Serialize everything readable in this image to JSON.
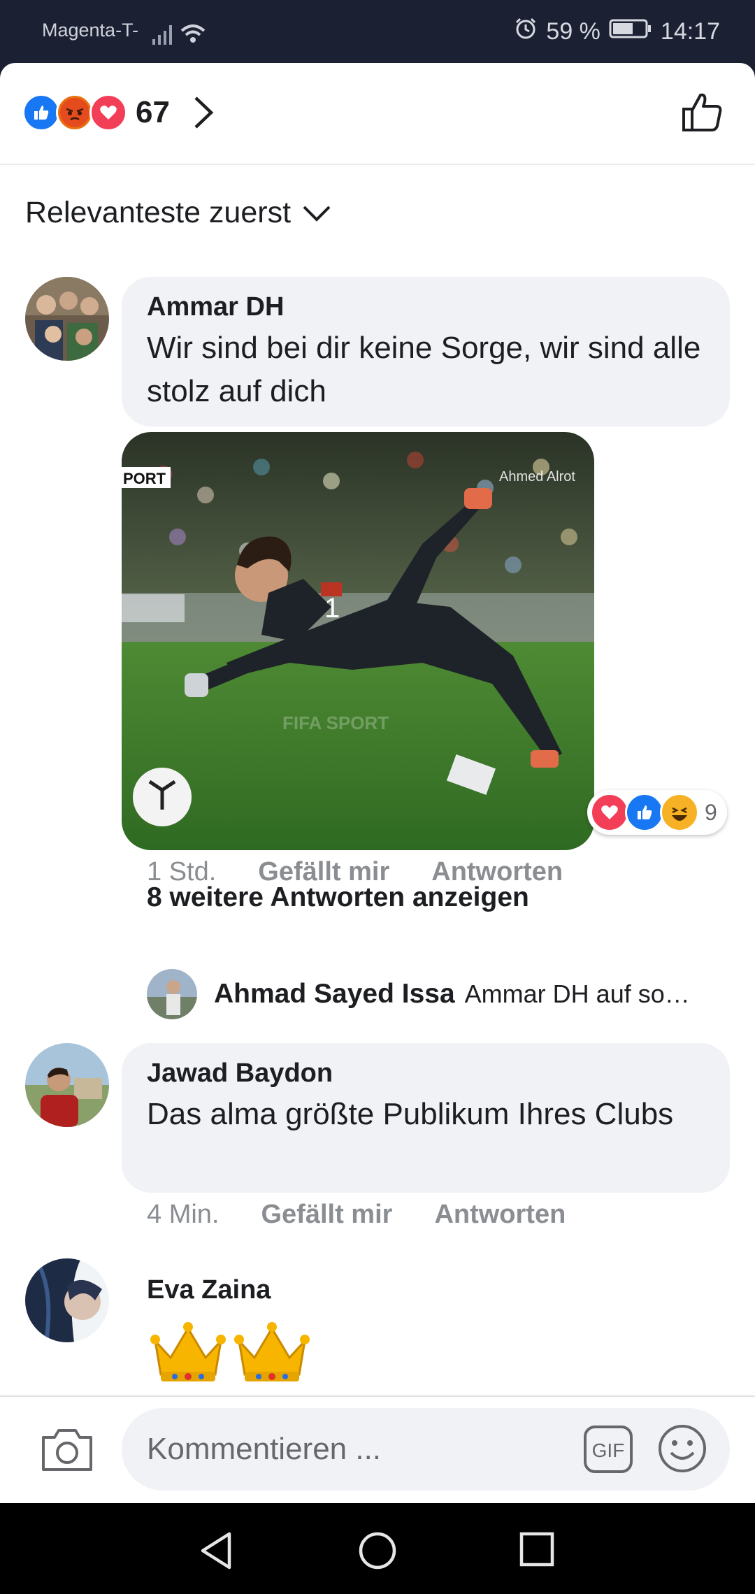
{
  "status_bar": {
    "carrier": "Magenta-T-",
    "battery": "59 %",
    "time": "14:17"
  },
  "header": {
    "reaction_count": "67",
    "reaction_icons": [
      "like-icon",
      "angry-icon",
      "love-icon"
    ]
  },
  "sort": {
    "label": "Relevanteste zuerst"
  },
  "comments": [
    {
      "author": "Ammar DH",
      "text": "Wir sind bei dir keine Sorge, wir sind alle stolz auf dich",
      "photo_watermark_left": "PORT",
      "photo_watermark_right": "Ahmed Alrot",
      "reaction_count": "9",
      "time": "1 Std.",
      "like_label": "Gefällt mir",
      "reply_label": "Antworten",
      "more_replies": "8 weitere Antworten anzeigen",
      "last_reply": {
        "author": "Ahmad Sayed Issa",
        "text": "Ammar DH auf so…"
      }
    },
    {
      "author": "Jawad Baydon",
      "text": "Das alma größte Publikum Ihres Clubs",
      "time": "4 Min.",
      "like_label": "Gefällt mir",
      "reply_label": "Antworten"
    },
    {
      "author": "Eva Zaina",
      "text": "👑👑"
    }
  ],
  "composer": {
    "placeholder": "Kommentieren ...",
    "gif_label": "GIF"
  },
  "colors": {
    "facebook_blue": "#1877f2",
    "love_red": "#f33e58",
    "bubble_bg": "#f0f2f5",
    "meta_gray": "#8a8d91"
  }
}
